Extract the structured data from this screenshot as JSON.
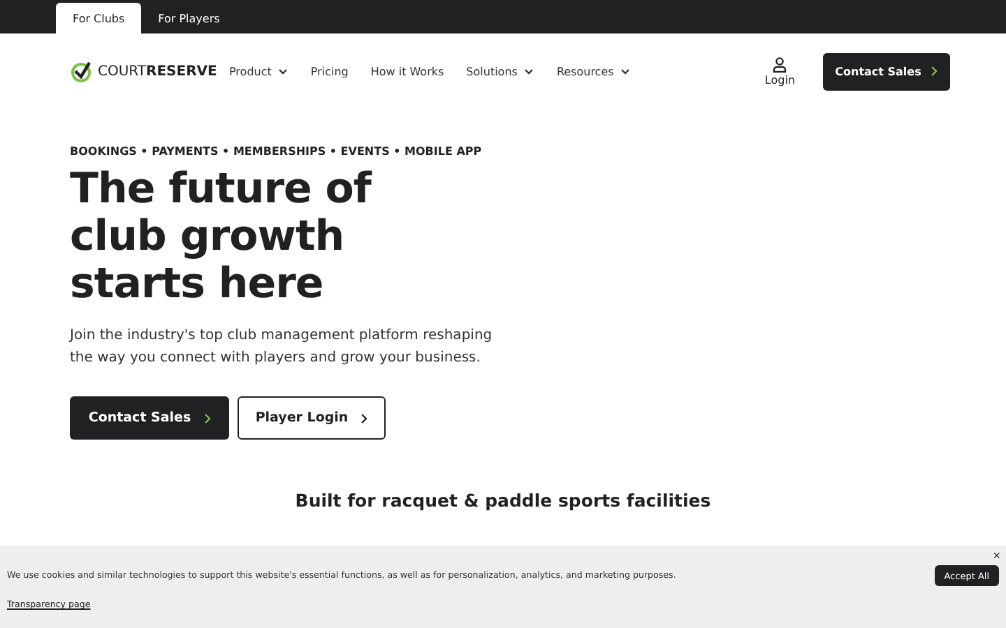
{
  "audience_tabs": [
    {
      "label": "For Clubs",
      "selected": true
    },
    {
      "label": "For Players",
      "selected": false
    }
  ],
  "nav": {
    "logo": "COURT**RESERVE**",
    "items": [
      {
        "label": "Product",
        "dropdown": true
      },
      {
        "label": "Pricing",
        "dropdown": false
      },
      {
        "label": "How it Works",
        "dropdown": false
      },
      {
        "label": "Solutions",
        "dropdown": true
      },
      {
        "label": "Resources",
        "dropdown": true
      }
    ],
    "login": "Login",
    "cta": "Contact Sales"
  },
  "hero": {
    "eyebrow": "BOOKINGS • PAYMENTS • MEMBERSHIPS • EVENTS • MOBILE APP",
    "headline": [
      "The future of",
      "club growth",
      "starts here"
    ],
    "description": "Join the industry's top club management platform reshaping the way you connect with players and grow your business.",
    "buttons": [
      {
        "label": "Contact Sales",
        "kind": "primary"
      },
      {
        "label": "Player Login",
        "kind": "secondary"
      }
    ]
  },
  "subheading": "Built for racquet & paddle sports facilities",
  "cookie_banner": {
    "close": "×",
    "message": "We use cookies and similar technologies to support this website's essential functions, as well as for personalization, analytics, and marketing purposes.",
    "accept": "Accept All",
    "link": "Transparency page"
  }
}
